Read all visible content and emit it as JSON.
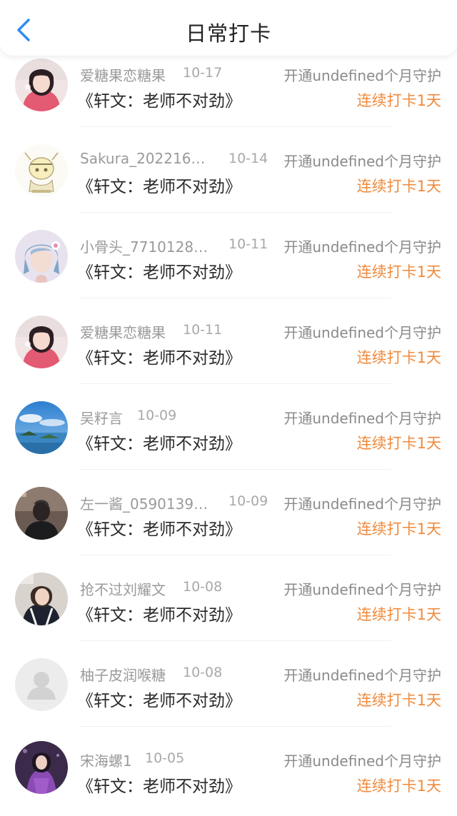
{
  "header": {
    "title": "日常打卡"
  },
  "colors": {
    "accent_blue": "#2f8cf6",
    "streak_orange": "#f08a3c",
    "meta_gray": "#9a9a9a"
  },
  "icons": {
    "back": "chevron-left-icon"
  },
  "entries": [
    {
      "name": "爱糖果恋糖果",
      "date": "10-17",
      "guard": "开通undefined个月守护",
      "book": "《轩文：老师不对劲》",
      "streak": "连续打卡1天",
      "avatar": "girl-pink-photo"
    },
    {
      "name": "Sakura_202216…",
      "date": "10-14",
      "guard": "开通undefined个月守护",
      "book": "《轩文：老师不对劲》",
      "streak": "连续打卡1天",
      "avatar": "cartoon-sketch"
    },
    {
      "name": "小骨头_7710128…",
      "date": "10-11",
      "guard": "开通undefined个月守护",
      "book": "《轩文：老师不对劲》",
      "streak": "连续打卡1天",
      "avatar": "girl-blue-hair-photo"
    },
    {
      "name": "爱糖果恋糖果",
      "date": "10-11",
      "guard": "开通undefined个月守护",
      "book": "《轩文：老师不对劲》",
      "streak": "连续打卡1天",
      "avatar": "girl-pink-photo"
    },
    {
      "name": "吴籽言",
      "date": "10-09",
      "guard": "开通undefined个月守护",
      "book": "《轩文：老师不对劲》",
      "streak": "连续打卡1天",
      "avatar": "seascape-photo"
    },
    {
      "name": "左一酱_0590139…",
      "date": "10-09",
      "guard": "开通undefined个月守护",
      "book": "《轩文：老师不对劲》",
      "streak": "连续打卡1天",
      "avatar": "dark-silhouette-photo"
    },
    {
      "name": "抢不过刘耀文",
      "date": "10-08",
      "guard": "开通undefined个月守护",
      "book": "《轩文：老师不对劲》",
      "streak": "连续打卡1天",
      "avatar": "person-selfie-photo"
    },
    {
      "name": "柚子皮润喉糖",
      "date": "10-08",
      "guard": "开通undefined个月守护",
      "book": "《轩文：老师不对劲》",
      "streak": "连续打卡1天",
      "avatar": "default-avatar"
    },
    {
      "name": "宋海螺1",
      "date": "10-05",
      "guard": "开通undefined个月守护",
      "book": "《轩文：老师不对劲》",
      "streak": "连续打卡1天",
      "avatar": "purple-dress-photo"
    }
  ]
}
